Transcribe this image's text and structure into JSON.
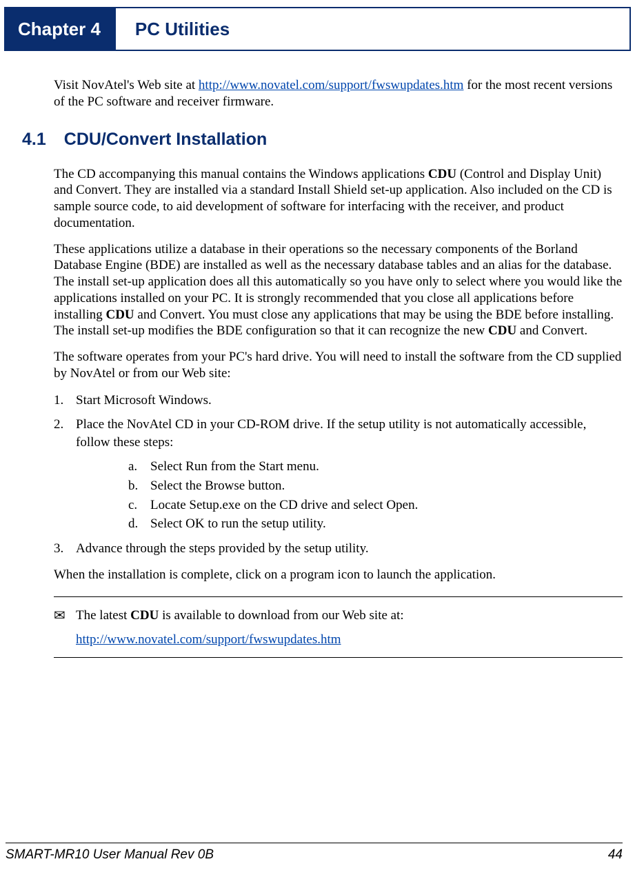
{
  "header": {
    "chapter": "Chapter 4",
    "title": "PC Utilities"
  },
  "intro": {
    "pre": "Visit NovAtel's Web site at ",
    "link": "http://www.novatel.com/support/fwswupdates.htm",
    "post": " for the most recent versions of the PC software and receiver firmware."
  },
  "section": {
    "num": "4.1",
    "title": "CDU/Convert Installation"
  },
  "p1": {
    "a": "The CD accompanying this manual contains the Windows applications ",
    "b": "CDU",
    "c": " (Control and Display Unit) and Convert. They are installed via a standard Install Shield set-up application. Also included on the CD is sample source code, to aid development of software for interfacing with the receiver, and product documentation."
  },
  "p2": {
    "a": "These applications utilize a database in their operations so the necessary components of the Borland Database Engine (BDE) are installed as well as the necessary database tables and an alias for the database. The install set-up application does all this automatically so you have only to select where you would like the applications installed on your PC. It is strongly recommended that you close all applications before installing ",
    "b": "CDU",
    "c": " and Convert. You must close any applications that may be using the BDE before installing. The install set-up modifies the BDE configuration so that it can recognize the new ",
    "d": "CDU",
    "e": " and Convert."
  },
  "p3": "The software operates from your PC's hard drive. You will need to install the software from the CD supplied by NovAtel or from our Web site:",
  "steps": {
    "1": {
      "num": "1.",
      "text": "Start Microsoft Windows."
    },
    "2": {
      "num": "2.",
      "text": "Place the NovAtel CD in your CD-ROM drive. If the setup utility is not automatically accessible, follow these steps:"
    },
    "3": {
      "num": "3.",
      "text": "Advance through the steps provided by the setup utility."
    }
  },
  "sub": {
    "a": {
      "letter": "a.",
      "text": "Select Run from the Start menu."
    },
    "b": {
      "letter": "b.",
      "text": "Select the Browse button."
    },
    "c": {
      "letter": "c.",
      "text": "Locate Setup.exe on the CD drive and select Open."
    },
    "d": {
      "letter": "d.",
      "text": "Select OK to run the setup utility."
    }
  },
  "done": "When the installation is complete, click on a program icon to launch the application.",
  "note": {
    "a": "The latest ",
    "b": "CDU",
    "c": " is available to download from our Web site at:",
    "link": "http://www.novatel.com/support/fwswupdates.htm"
  },
  "footer": {
    "left": "SMART-MR10 User Manual Rev 0B",
    "right": "44"
  }
}
